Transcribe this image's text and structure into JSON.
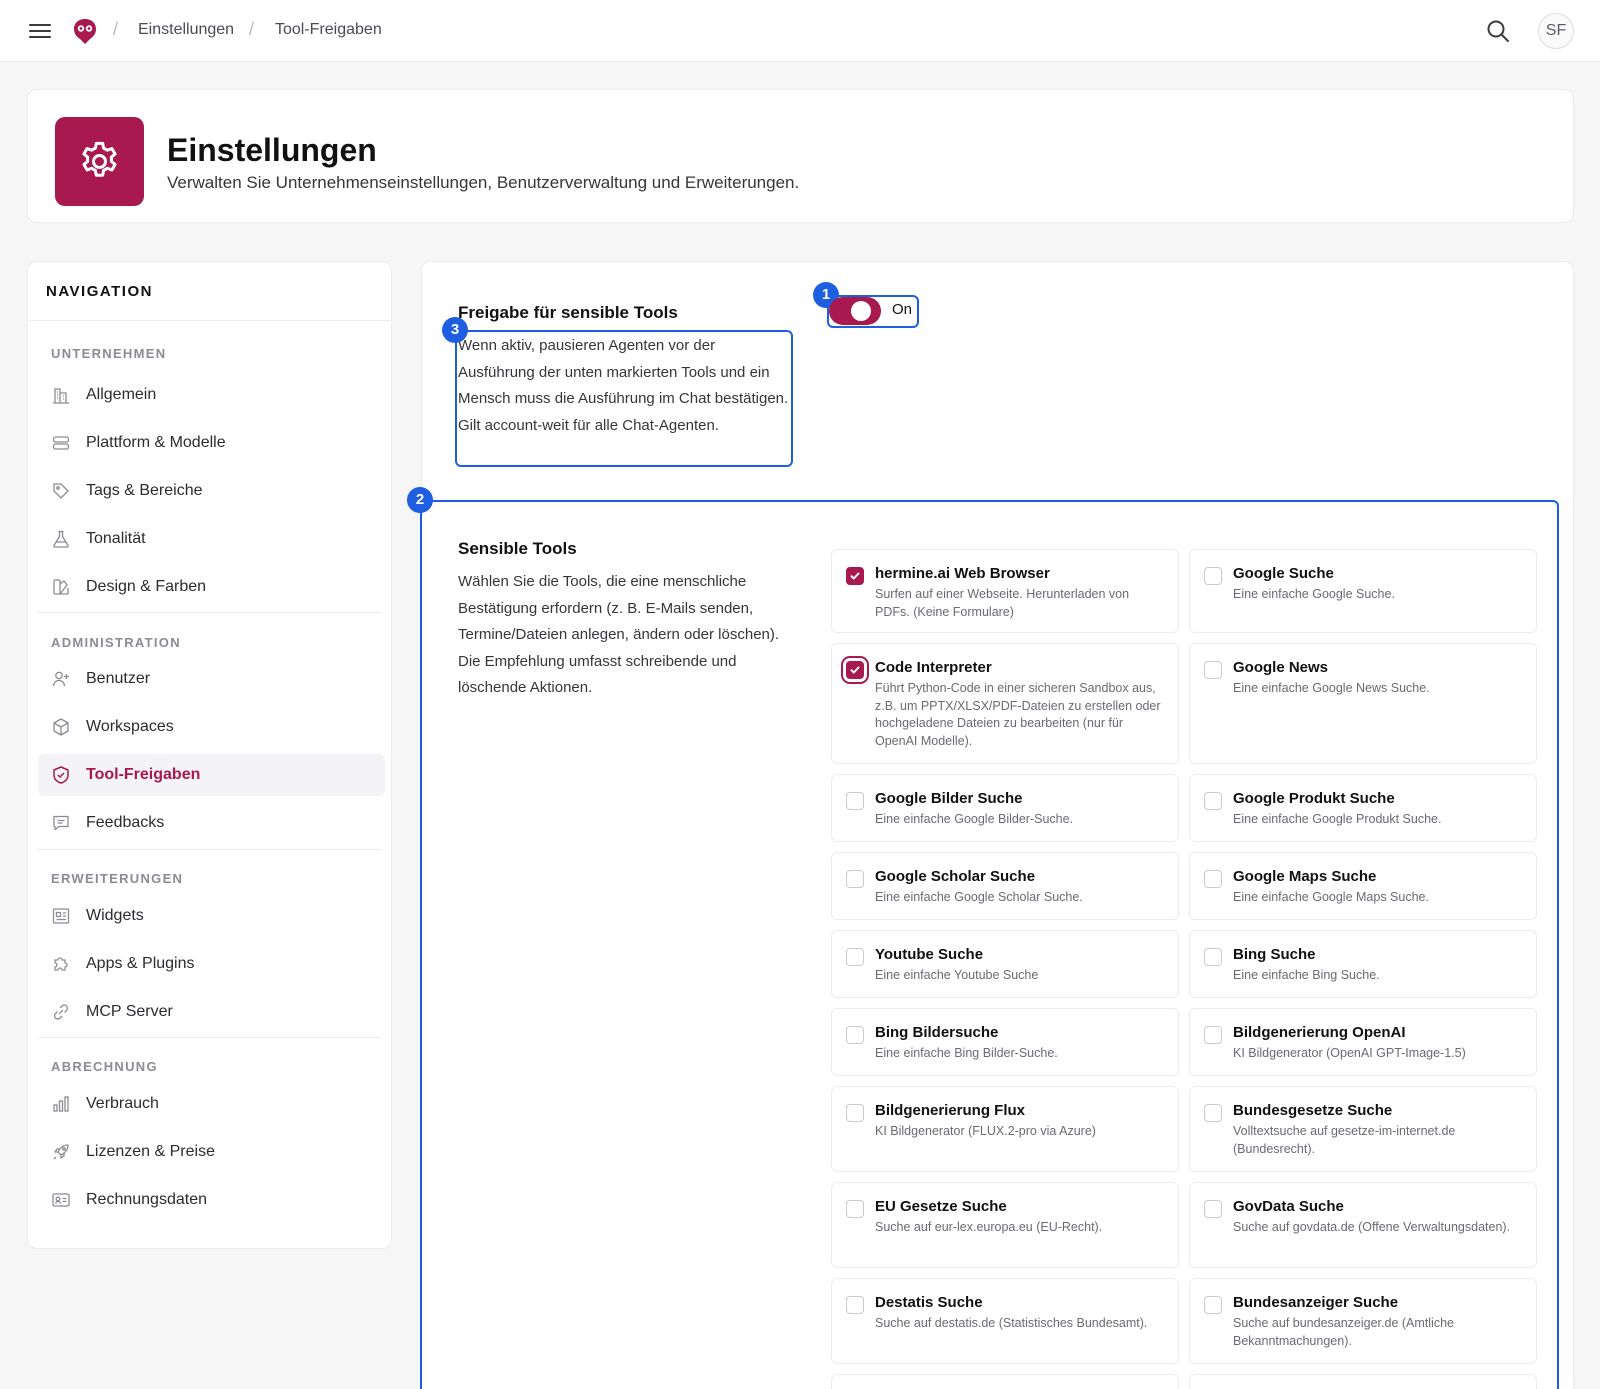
{
  "topbar": {
    "breadcrumb": [
      "Einstellungen",
      "Tool-Freigaben"
    ],
    "avatar_initials": "SF"
  },
  "header": {
    "title": "Einstellungen",
    "subtitle": "Verwalten Sie Unternehmenseinstellungen, Benutzerverwaltung und Erweiterungen."
  },
  "sidebar": {
    "title": "NAVIGATION",
    "sections": [
      {
        "label": "UNTERNEHMEN",
        "items": [
          "Allgemein",
          "Plattform & Modelle",
          "Tags & Bereiche",
          "Tonalität",
          "Design & Farben"
        ]
      },
      {
        "label": "ADMINISTRATION",
        "items": [
          "Benutzer",
          "Workspaces",
          "Tool-Freigaben",
          "Feedbacks"
        ]
      },
      {
        "label": "ERWEITERUNGEN",
        "items": [
          "Widgets",
          "Apps & Plugins",
          "MCP Server"
        ]
      },
      {
        "label": "ABRECHNUNG",
        "items": [
          "Verbrauch",
          "Lizenzen & Preise",
          "Rechnungsdaten"
        ]
      }
    ],
    "active_item": "Tool-Freigaben"
  },
  "approval": {
    "title": "Freigabe für sensible Tools",
    "description": "Wenn aktiv, pausieren Agenten vor der Ausführung der unten markierten Tools und ein Mensch muss die Ausführung im Chat bestätigen. Gilt account-weit für alle Chat-Agenten.",
    "toggle_label": "On",
    "toggle_on": true
  },
  "annotations": [
    "1",
    "2",
    "3"
  ],
  "tools_section": {
    "title": "Sensible Tools",
    "description": "Wählen Sie die Tools, die eine menschliche Bestätigung erfordern (z. B. E-Mails senden, Termine/Dateien anlegen, ändern oder löschen). Die Empfehlung umfasst schreibende und löschende Aktionen.",
    "tools": [
      {
        "name": "hermine.ai Web Browser",
        "description": "Surfen auf einer Webseite. Herunterladen von PDFs. (Keine Formulare)",
        "checked": true
      },
      {
        "name": "Google Suche",
        "description": "Eine einfache Google Suche.",
        "checked": false
      },
      {
        "name": "Code Interpreter",
        "description": "Führt Python-Code in einer sicheren Sandbox aus, z.B. um PPTX/XLSX/PDF-Dateien zu erstellen oder hochgeladene Dateien zu bearbeiten (nur für OpenAI Modelle).",
        "checked": true
      },
      {
        "name": "Google News",
        "description": "Eine einfache Google News Suche.",
        "checked": false
      },
      {
        "name": "Google Bilder Suche",
        "description": "Eine einfache Google Bilder-Suche.",
        "checked": false
      },
      {
        "name": "Google Produkt Suche",
        "description": "Eine einfache Google Produkt Suche.",
        "checked": false
      },
      {
        "name": "Google Scholar Suche",
        "description": "Eine einfache Google Scholar Suche.",
        "checked": false
      },
      {
        "name": "Google Maps Suche",
        "description": "Eine einfache Google Maps Suche.",
        "checked": false
      },
      {
        "name": "Youtube Suche",
        "description": "Eine einfache Youtube Suche",
        "checked": false
      },
      {
        "name": "Bing Suche",
        "description": "Eine einfache Bing Suche.",
        "checked": false
      },
      {
        "name": "Bing Bildersuche",
        "description": "Eine einfache Bing Bilder-Suche.",
        "checked": false
      },
      {
        "name": "Bildgenerierung OpenAI",
        "description": "KI Bildgenerator (OpenAI GPT-Image-1.5)",
        "checked": false
      },
      {
        "name": "Bildgenerierung Flux",
        "description": "KI Bildgenerator (FLUX.2-pro via Azure)",
        "checked": false
      },
      {
        "name": "Bundesgesetze Suche",
        "description": "Volltextsuche auf gesetze-im-internet.de (Bundesrecht).",
        "checked": false
      },
      {
        "name": "EU Gesetze Suche",
        "description": "Suche auf eur-lex.europa.eu (EU-Recht).",
        "checked": false
      },
      {
        "name": "GovData Suche",
        "description": "Suche auf govdata.de (Offene Verwaltungsdaten).",
        "checked": false
      },
      {
        "name": "Destatis Suche",
        "description": "Suche auf destatis.de (Statistisches Bundesamt).",
        "checked": false
      },
      {
        "name": "Bundesanzeiger Suche",
        "description": "Suche auf bundesanzeiger.de (Amtliche Bekanntmachungen).",
        "checked": false
      }
    ]
  },
  "colors": {
    "brand": "#a8194f",
    "annotation": "#1d5fe0"
  }
}
